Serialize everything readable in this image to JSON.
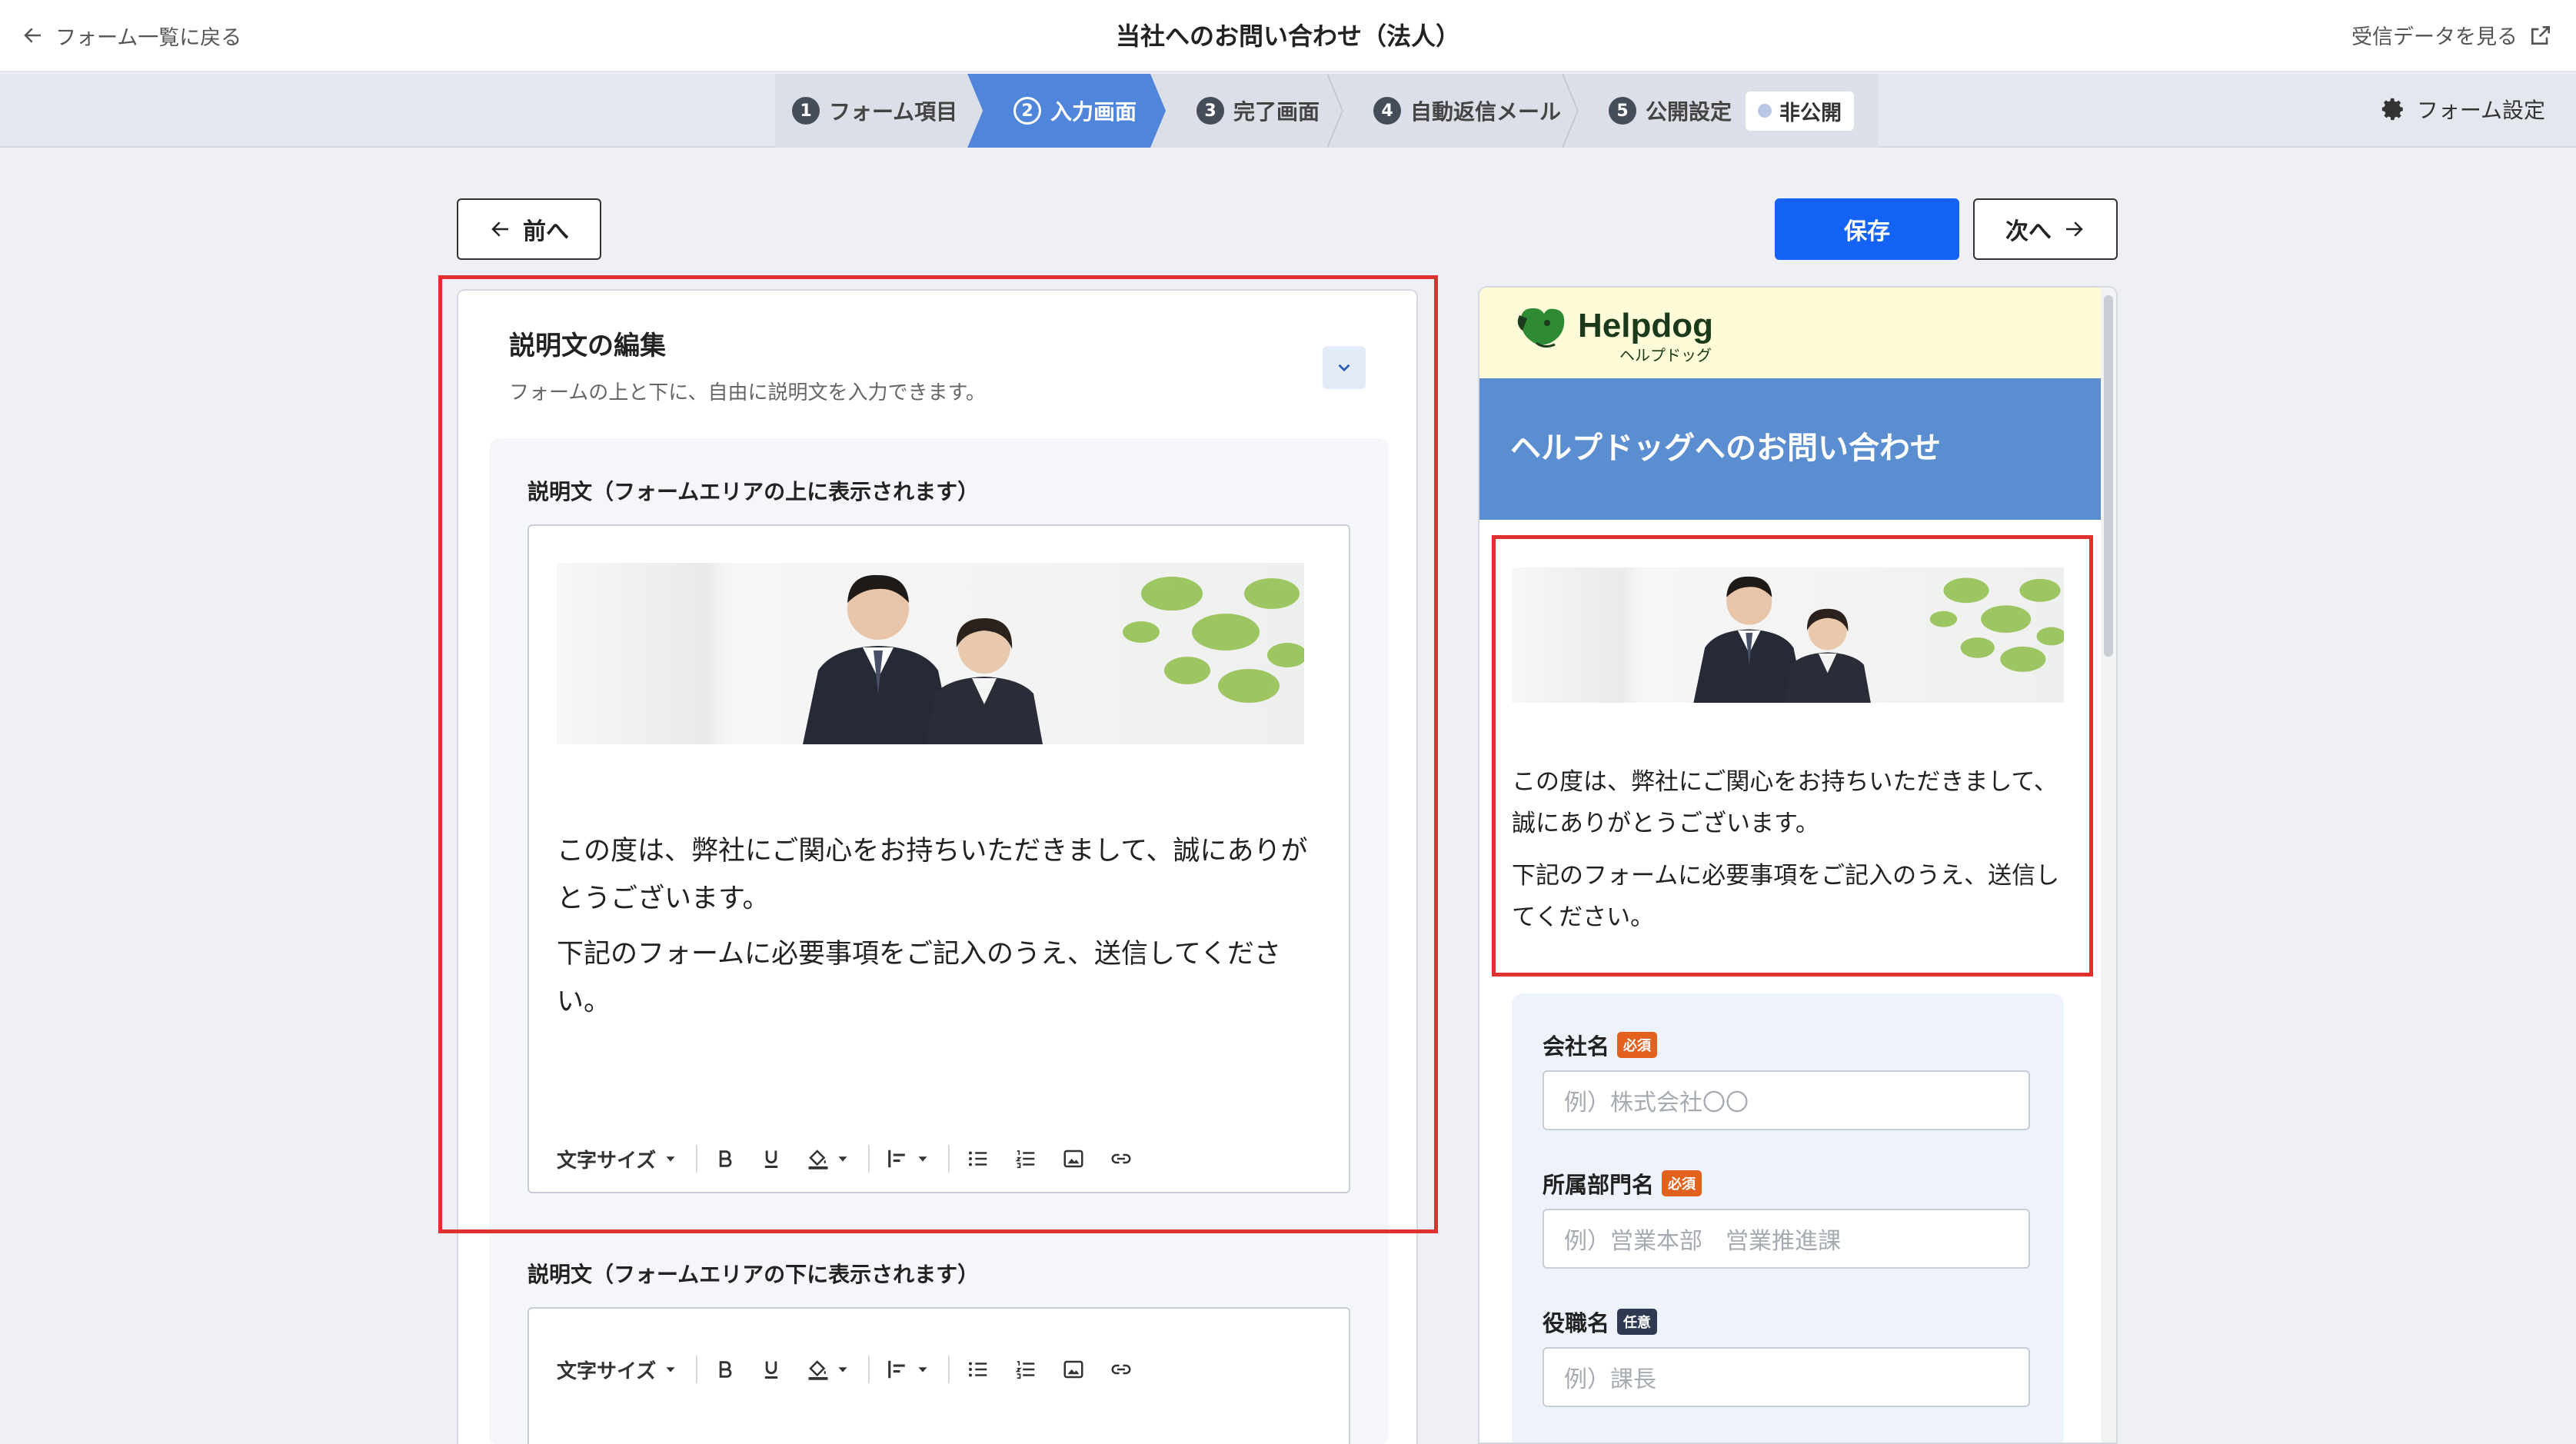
{
  "topbar": {
    "back_label": "フォーム一覧に戻る",
    "title": "当社へのお問い合わせ（法人）",
    "view_data_label": "受信データを見る"
  },
  "steps": [
    {
      "num": "1",
      "label": "フォーム項目"
    },
    {
      "num": "2",
      "label": "入力画面"
    },
    {
      "num": "3",
      "label": "完了画面"
    },
    {
      "num": "4",
      "label": "自動返信メール"
    },
    {
      "num": "5",
      "label": "公開設定"
    }
  ],
  "publish_status": "非公開",
  "active_step": "入力画面",
  "form_settings_label": "フォーム設定",
  "buttons": {
    "prev": "前へ",
    "save": "保存",
    "next": "次へ"
  },
  "editor": {
    "title": "説明文の編集",
    "subtitle": "フォームの上と下に、自由に説明文を入力できます。",
    "top_label": "説明文（フォームエリアの上に表示されます）",
    "bottom_label": "説明文（フォームエリアの下に表示されます）",
    "paragraph1": "この度は、弊社にご関心をお持ちいただきまして、誠にありがとうございます。",
    "paragraph2": "下記のフォームに必要事項をご記入のうえ、送信してください。",
    "toolbar_font_size": "文字サイズ"
  },
  "preview": {
    "logo_name": "Helpdog",
    "logo_sub": "ヘルプドッグ",
    "header_title": "ヘルプドッグへのお問い合わせ",
    "paragraph1": "この度は、弊社にご関心をお持ちいただきまして、誠にありがとうございます。",
    "paragraph2": "下記のフォームに必要事項をご記入のうえ、送信してください。",
    "fields": [
      {
        "label": "会社名",
        "badge": "必須",
        "placeholder": "例）株式会社〇〇"
      },
      {
        "label": "所属部門名",
        "badge": "必須",
        "placeholder": "例）営業本部　営業推進課"
      },
      {
        "label": "役職名",
        "badge": "任意",
        "placeholder": "例）課長"
      }
    ]
  },
  "colors": {
    "accent": "#1463f4",
    "active_step": "#4f86dc",
    "preview_header": "#5b8ed1",
    "highlight": "#e03030",
    "required_badge": "#e2611f",
    "optional_badge": "#2f3a52"
  }
}
